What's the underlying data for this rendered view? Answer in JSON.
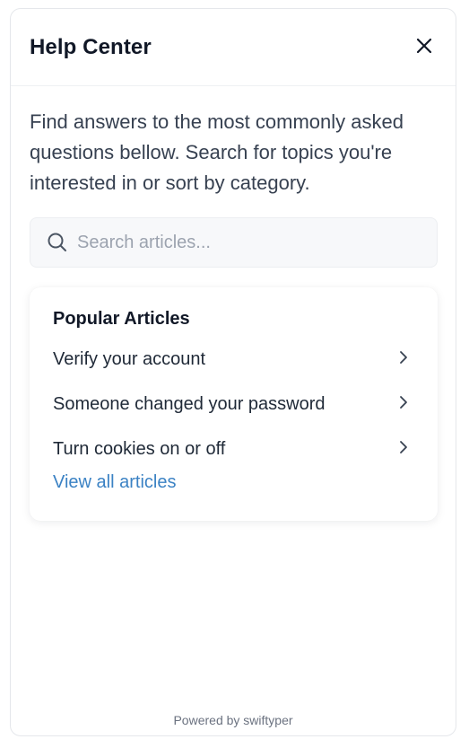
{
  "header": {
    "title": "Help Center",
    "close_icon": "close-icon"
  },
  "intro": {
    "text": "Find answers to the most commonly asked questions bellow. Search for topics you're interested in or sort by category."
  },
  "search": {
    "placeholder": "Search articles...",
    "value": "",
    "icon": "search-icon"
  },
  "popular": {
    "title": "Popular Articles",
    "articles": [
      {
        "label": "Verify your account",
        "icon": "chevron-right-icon"
      },
      {
        "label": "Someone changed your password",
        "icon": "chevron-right-icon"
      },
      {
        "label": "Turn cookies on or off",
        "icon": "chevron-right-icon"
      }
    ],
    "view_all_label": "View all articles"
  },
  "footer": {
    "powered_by": "Powered by swiftyper"
  },
  "colors": {
    "link": "#3b82c4",
    "text": "#111827",
    "muted": "#6b7280",
    "search_bg": "#f7f8fa"
  }
}
